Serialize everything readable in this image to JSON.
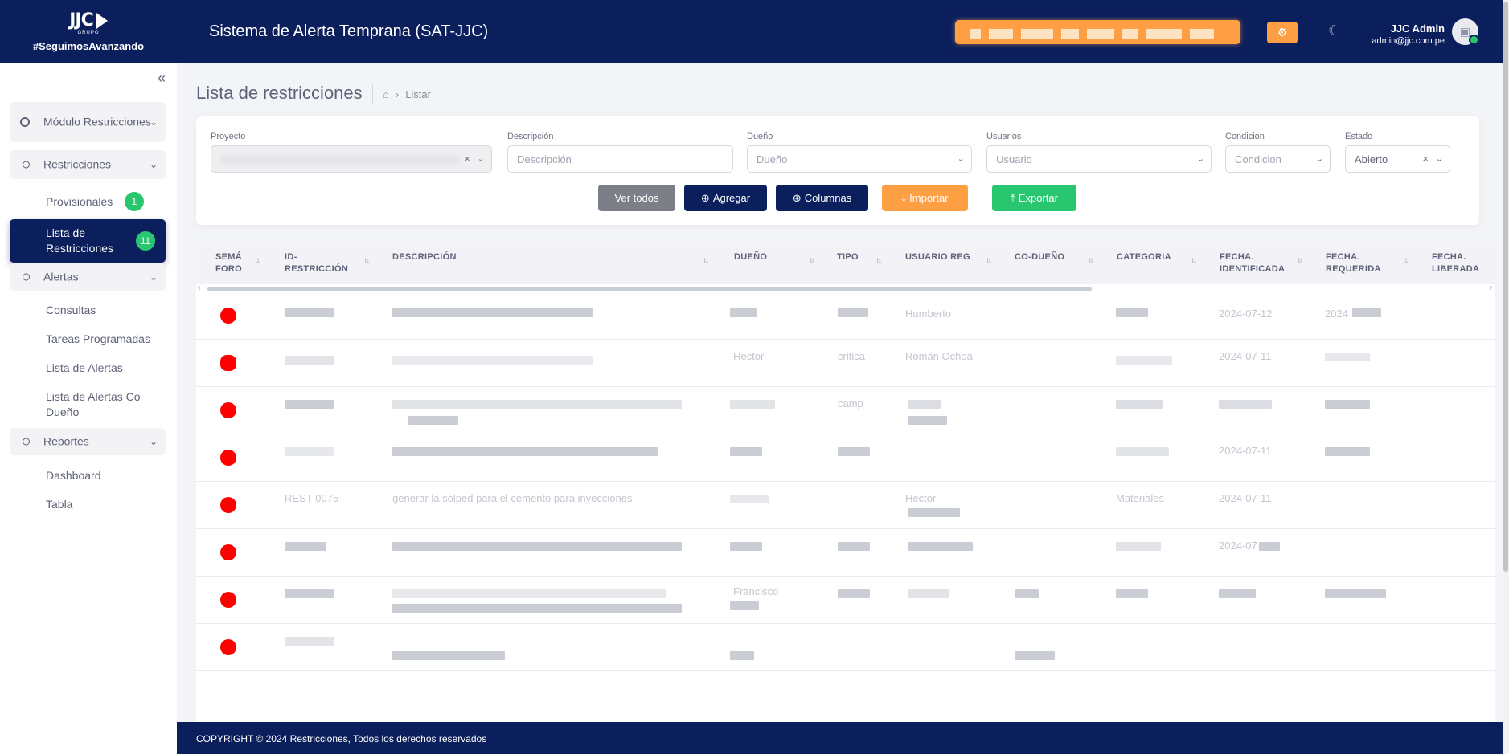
{
  "header": {
    "logo_text": "JJC",
    "logo_sub": "GRUPO",
    "tagline": "#SeguimosAvanzando",
    "app_title": "Sistema de Alerta Temprana (SAT-JJC)",
    "user_name": "JJC Admin",
    "user_email": "admin@jjc.com.pe",
    "accent": "#ff9f43",
    "brand_color": "#0b1f5c"
  },
  "sidebar": {
    "groups": [
      {
        "label": "Módulo Restricciones",
        "icon": "target-icon"
      },
      {
        "label": "Restricciones",
        "icon": "circle-icon"
      },
      {
        "label": "Alertas",
        "icon": "circle-icon"
      },
      {
        "label": "Reportes",
        "icon": "circle-icon"
      }
    ],
    "links": {
      "provisionales": "Provisionales",
      "provisionales_count": "1",
      "lista_restricciones": "Lista de Restricciones",
      "lista_restricciones_count": "11",
      "consultas": "Consultas",
      "tareas": "Tareas Programadas",
      "lista_alertas": "Lista de Alertas",
      "lista_alertas_codueno": "Lista de Alertas Co Dueño",
      "dashboard": "Dashboard",
      "tabla": "Tabla"
    }
  },
  "page": {
    "title": "Lista de restricciones",
    "breadcrumb_current": "Listar"
  },
  "filters": {
    "proyecto_label": "Proyecto",
    "descripcion_label": "Descripción",
    "descripcion_placeholder": "Descripción",
    "dueno_label": "Dueño",
    "dueno_placeholder": "Dueño",
    "usuarios_label": "Usuarios",
    "usuarios_placeholder": "Usuario",
    "condicion_label": "Condicion",
    "condicion_placeholder": "Condicion",
    "estado_label": "Estado",
    "estado_value": "Abierto"
  },
  "buttons": {
    "ver_todos": "Ver todos",
    "agregar": "Agregar",
    "columnas": "Columnas",
    "importar": "Importar",
    "exportar": "Exportar"
  },
  "table": {
    "columns": [
      "SEMÁ FORO",
      "ID-RESTRICCIÓN",
      "DESCRIPCIÓN",
      "DUEÑO",
      "TIPO",
      "USUARIO REG",
      "CO-DUEÑO",
      "CATEGORIA",
      "FECHA. IDENTIFICADA",
      "FECHA. REQUERIDA",
      "FECHA. LIBERADA"
    ],
    "rows": [
      {
        "id": "",
        "descripcion": "",
        "dueno": "",
        "tipo": "",
        "usuario": "Humberto",
        "codueno": "",
        "categoria": "",
        "f_ident": "2024-07-12",
        "f_req": "2024",
        "semaforo": "red"
      },
      {
        "id": "",
        "descripcion": "",
        "dueno": "Hector",
        "tipo": "critica",
        "usuario": "Román Ochoa",
        "codueno": "",
        "categoria": "",
        "f_ident": "2024-07-11",
        "f_req": "",
        "semaforo": "red"
      },
      {
        "id": "",
        "descripcion": "",
        "dueno": "",
        "tipo": "camp",
        "usuario": "",
        "codueno": "",
        "categoria": "",
        "f_ident": "",
        "f_req": "",
        "semaforo": "red"
      },
      {
        "id": "",
        "descripcion": "",
        "dueno": "",
        "tipo": "",
        "usuario": "",
        "codueno": "",
        "categoria": "",
        "f_ident": "2024-07-11",
        "f_req": "",
        "semaforo": "red"
      },
      {
        "id": "REST-0075",
        "descripcion": "generar la solped para el cemento para inyecciones",
        "dueno": "",
        "tipo": "",
        "usuario": "Hector",
        "codueno": "",
        "categoria": "Materiales",
        "f_ident": "2024-07-11",
        "f_req": "",
        "semaforo": "red"
      },
      {
        "id": "",
        "descripcion": "",
        "dueno": "",
        "tipo": "",
        "usuario": "",
        "codueno": "",
        "categoria": "",
        "f_ident": "2024-07",
        "f_req": "",
        "semaforo": "red"
      },
      {
        "id": "",
        "descripcion": "",
        "dueno": "Francisco",
        "tipo": "",
        "usuario": "",
        "codueno": "",
        "categoria": "",
        "f_ident": "",
        "f_req": "",
        "semaforo": "red"
      },
      {
        "id": "",
        "descripcion": "",
        "dueno": "",
        "tipo": "",
        "usuario": "",
        "codueno": "",
        "categoria": "",
        "f_ident": "",
        "f_req": "",
        "semaforo": "red"
      }
    ]
  },
  "footer": {
    "text": "COPYRIGHT © 2024  Restricciones, Todos los derechos reservados"
  }
}
